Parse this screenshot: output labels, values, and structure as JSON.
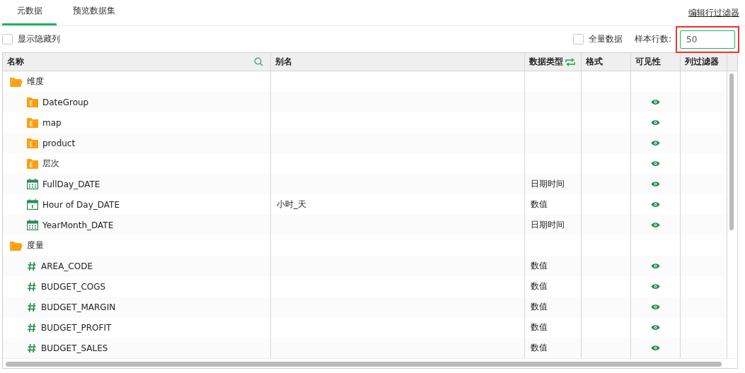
{
  "tabs": [
    {
      "label": "元数据",
      "selected": true
    },
    {
      "label": "预览数据集",
      "selected": false
    }
  ],
  "edit_row_filter_link": "编辑行过滤器",
  "show_hidden_columns": {
    "label": "显示隐藏列",
    "checked": false
  },
  "full_data": {
    "label": "全量数据",
    "checked": false
  },
  "sample_rows": {
    "label": "样本行数:",
    "value": "50",
    "highlighted": true
  },
  "table": {
    "columns": [
      {
        "label": "名称"
      },
      {
        "label": "别名"
      },
      {
        "label": "数据类型"
      },
      {
        "label": "格式"
      },
      {
        "label": "可见性"
      },
      {
        "label": "列过滤器"
      }
    ],
    "groups": [
      {
        "name": "维度",
        "children": [
          {
            "kind": "hierarchy",
            "name": "DateGroup",
            "visible": true
          },
          {
            "kind": "hierarchy",
            "name": "map",
            "visible": true
          },
          {
            "kind": "hierarchy",
            "name": "product",
            "visible": true
          },
          {
            "kind": "hierarchy",
            "name": "层次",
            "visible": true
          },
          {
            "kind": "date",
            "name": "FullDay_DATE",
            "type": "日期时间",
            "visible": true
          },
          {
            "kind": "day",
            "name": "Hour of Day_DATE",
            "alias": "小时_天",
            "type": "数值",
            "visible": true
          },
          {
            "kind": "date",
            "name": "YearMonth_DATE",
            "type": "日期时间",
            "visible": true
          }
        ]
      },
      {
        "name": "度量",
        "children": [
          {
            "kind": "measure",
            "name": "AREA_CODE",
            "type": "数值",
            "visible": true
          },
          {
            "kind": "measure",
            "name": "BUDGET_COGS",
            "type": "数值",
            "visible": true
          },
          {
            "kind": "measure",
            "name": "BUDGET_MARGIN",
            "type": "数值",
            "visible": true
          },
          {
            "kind": "measure",
            "name": "BUDGET_PROFIT",
            "type": "数值",
            "visible": true
          },
          {
            "kind": "measure",
            "name": "BUDGET_SALES",
            "type": "数值",
            "visible": true
          }
        ]
      }
    ]
  }
}
